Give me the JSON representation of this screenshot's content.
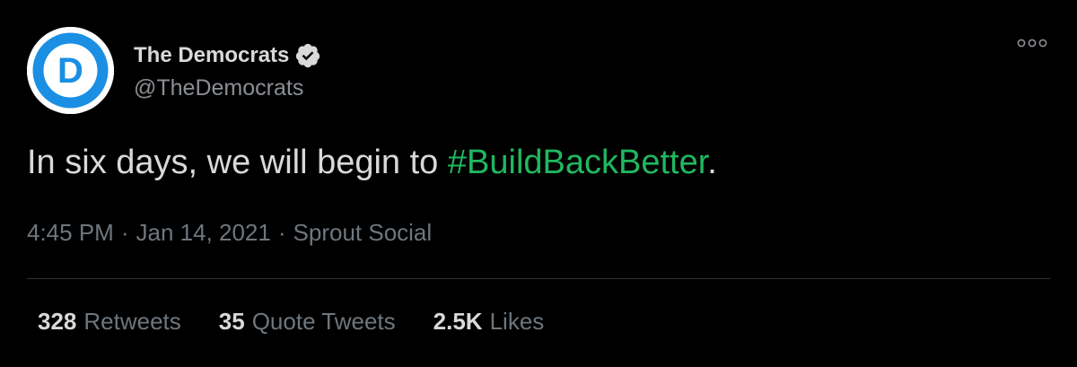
{
  "colors": {
    "background": "#000000",
    "text": "#d9d9d9",
    "secondary_text": "#6e767d",
    "hashtag": "#1fb860",
    "avatar_blue": "#1a8fe3",
    "verified_badge": "#d9d9d9"
  },
  "author": {
    "display_name": "The Democrats",
    "handle": "@TheDemocrats",
    "avatar_letter": "D",
    "verified_icon": "verified-badge-icon"
  },
  "tweet": {
    "text_before": "In six days, we will begin to ",
    "hashtag": "#BuildBackBetter",
    "text_after": "."
  },
  "meta": {
    "time": "4:45 PM",
    "separator": "·",
    "date": "Jan 14, 2021",
    "source": "Sprout Social"
  },
  "stats": [
    {
      "value": "328",
      "label": "Retweets"
    },
    {
      "value": "35",
      "label": "Quote Tweets"
    },
    {
      "value": "2.5K",
      "label": "Likes"
    }
  ],
  "more_icon": "more-options-icon"
}
